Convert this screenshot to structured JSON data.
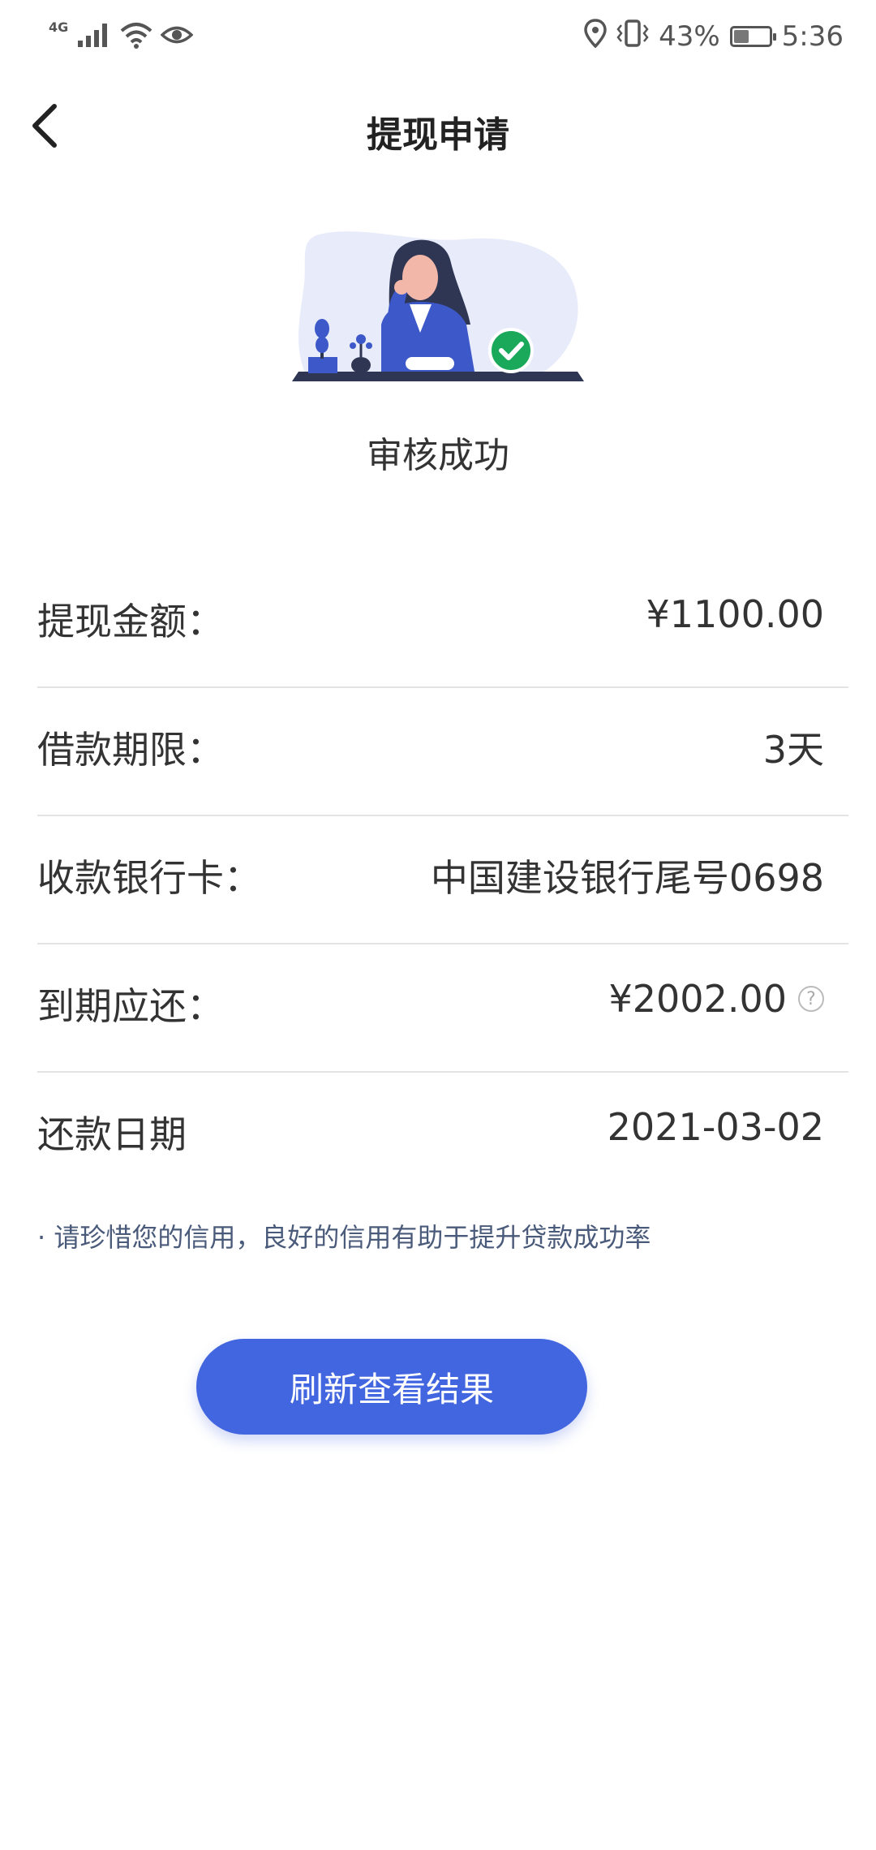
{
  "status_bar": {
    "network": "4G",
    "battery_percent": "43%",
    "battery_level": 0.43,
    "time": "5:36",
    "icons": [
      "signal-icon",
      "wifi-icon",
      "eye-icon",
      "location-icon",
      "vibrate-icon",
      "battery-icon"
    ]
  },
  "header": {
    "title": "提现申请",
    "back_icon": "chevron-left-icon"
  },
  "result": {
    "status_text": "审核成功",
    "illustration": "woman-at-desk-success-illustration"
  },
  "details": [
    {
      "label": "提现金额：",
      "value": "¥1100.00"
    },
    {
      "label": "借款期限：",
      "value": "3天"
    },
    {
      "label": "收款银行卡：",
      "value": "中国建设银行尾号0698"
    },
    {
      "label": "到期应还：",
      "value": "¥2002.00",
      "help": "?"
    },
    {
      "label": "还款日期",
      "value": "2021-03-02"
    }
  ],
  "notice": "· 请珍惜您的信用，良好的信用有助于提升贷款成功率",
  "button": {
    "label": "刷新查看结果"
  },
  "colors": {
    "accent": "#4265e0",
    "success": "#1aa85a",
    "divider": "#e3e3e3"
  }
}
